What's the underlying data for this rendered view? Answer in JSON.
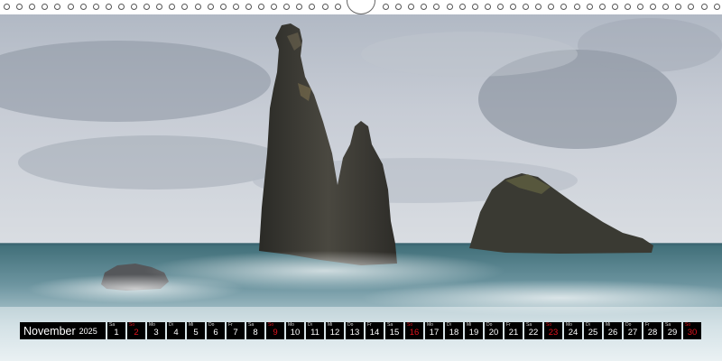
{
  "calendar": {
    "month": "November",
    "year": "2025",
    "days": [
      {
        "dow": "Sa",
        "num": "1",
        "red": false
      },
      {
        "dow": "So",
        "num": "2",
        "red": true
      },
      {
        "dow": "Mo",
        "num": "3",
        "red": false
      },
      {
        "dow": "Di",
        "num": "4",
        "red": false
      },
      {
        "dow": "Mi",
        "num": "5",
        "red": false
      },
      {
        "dow": "Do",
        "num": "6",
        "red": false
      },
      {
        "dow": "Fr",
        "num": "7",
        "red": false
      },
      {
        "dow": "Sa",
        "num": "8",
        "red": false
      },
      {
        "dow": "So",
        "num": "9",
        "red": true
      },
      {
        "dow": "Mo",
        "num": "10",
        "red": false
      },
      {
        "dow": "Di",
        "num": "11",
        "red": false
      },
      {
        "dow": "Mi",
        "num": "12",
        "red": false
      },
      {
        "dow": "Do",
        "num": "13",
        "red": false
      },
      {
        "dow": "Fr",
        "num": "14",
        "red": false
      },
      {
        "dow": "Sa",
        "num": "15",
        "red": false
      },
      {
        "dow": "So",
        "num": "16",
        "red": true
      },
      {
        "dow": "Mo",
        "num": "17",
        "red": false
      },
      {
        "dow": "Di",
        "num": "18",
        "red": false
      },
      {
        "dow": "Mi",
        "num": "19",
        "red": false
      },
      {
        "dow": "Do",
        "num": "20",
        "red": false
      },
      {
        "dow": "Fr",
        "num": "21",
        "red": false
      },
      {
        "dow": "Sa",
        "num": "22",
        "red": false
      },
      {
        "dow": "So",
        "num": "23",
        "red": true
      },
      {
        "dow": "Mo",
        "num": "24",
        "red": false
      },
      {
        "dow": "Di",
        "num": "25",
        "red": false
      },
      {
        "dow": "Mi",
        "num": "26",
        "red": false
      },
      {
        "dow": "Do",
        "num": "27",
        "red": false
      },
      {
        "dow": "Fr",
        "num": "28",
        "red": false
      },
      {
        "dow": "Sa",
        "num": "29",
        "red": false
      },
      {
        "dow": "So",
        "num": "30",
        "red": true
      }
    ]
  },
  "colors": {
    "strip_background": "#000000",
    "sunday_red": "#e0141e",
    "sky": "#c9ced6",
    "sea": "#4e7f86",
    "rock": "#3c3b35"
  }
}
